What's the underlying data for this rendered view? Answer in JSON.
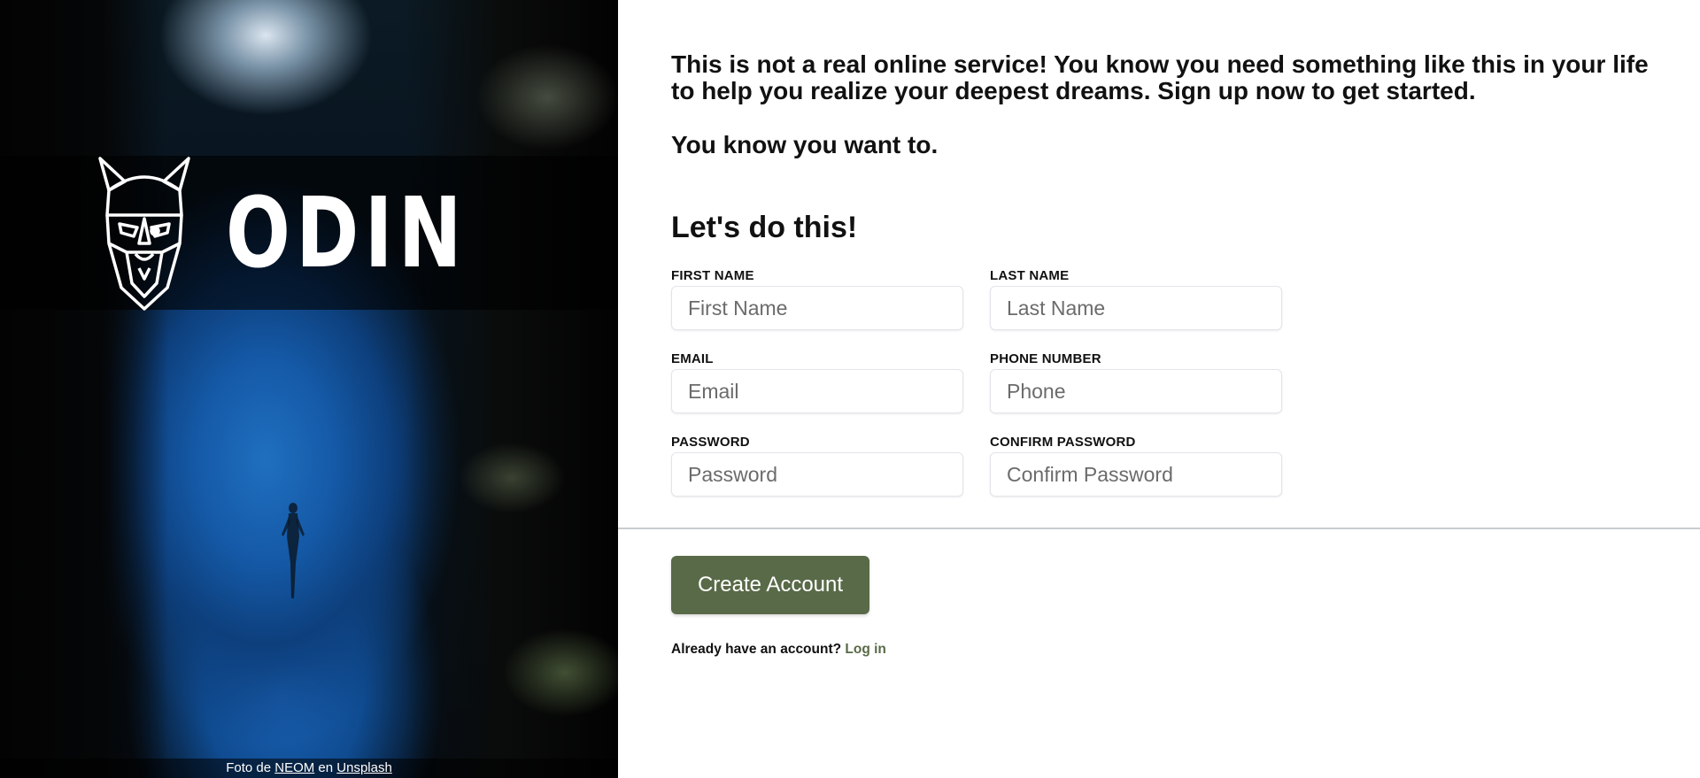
{
  "hero": {
    "logo_text": "ODIN",
    "credit": {
      "prefix": "Foto de",
      "author": "NEOM",
      "middle": "en",
      "source": "Unsplash"
    }
  },
  "intro": {
    "paragraph": "This is not a real online service! You know you need something like this in your life to help you realize your deepest dreams. Sign up now to get started.",
    "tagline": "You know you want to."
  },
  "form": {
    "title": "Let's do this!",
    "fields": [
      {
        "label": "FIRST NAME",
        "placeholder": "First Name",
        "value": ""
      },
      {
        "label": "LAST NAME",
        "placeholder": "Last Name",
        "value": ""
      },
      {
        "label": "EMAIL",
        "placeholder": "Email",
        "value": ""
      },
      {
        "label": "PHONE NUMBER",
        "placeholder": "Phone",
        "value": ""
      },
      {
        "label": "PASSWORD",
        "placeholder": "Password",
        "value": ""
      },
      {
        "label": "CONFIRM PASSWORD",
        "placeholder": "Confirm Password",
        "value": ""
      }
    ],
    "submit_label": "Create Account",
    "login_prompt": "Already have an account?",
    "login_link": "Log in"
  },
  "colors": {
    "accent": "#596a48",
    "text": "#111111",
    "input_border": "#e2e5ea"
  },
  "icons": {
    "logo": "viking-helmet-icon"
  }
}
